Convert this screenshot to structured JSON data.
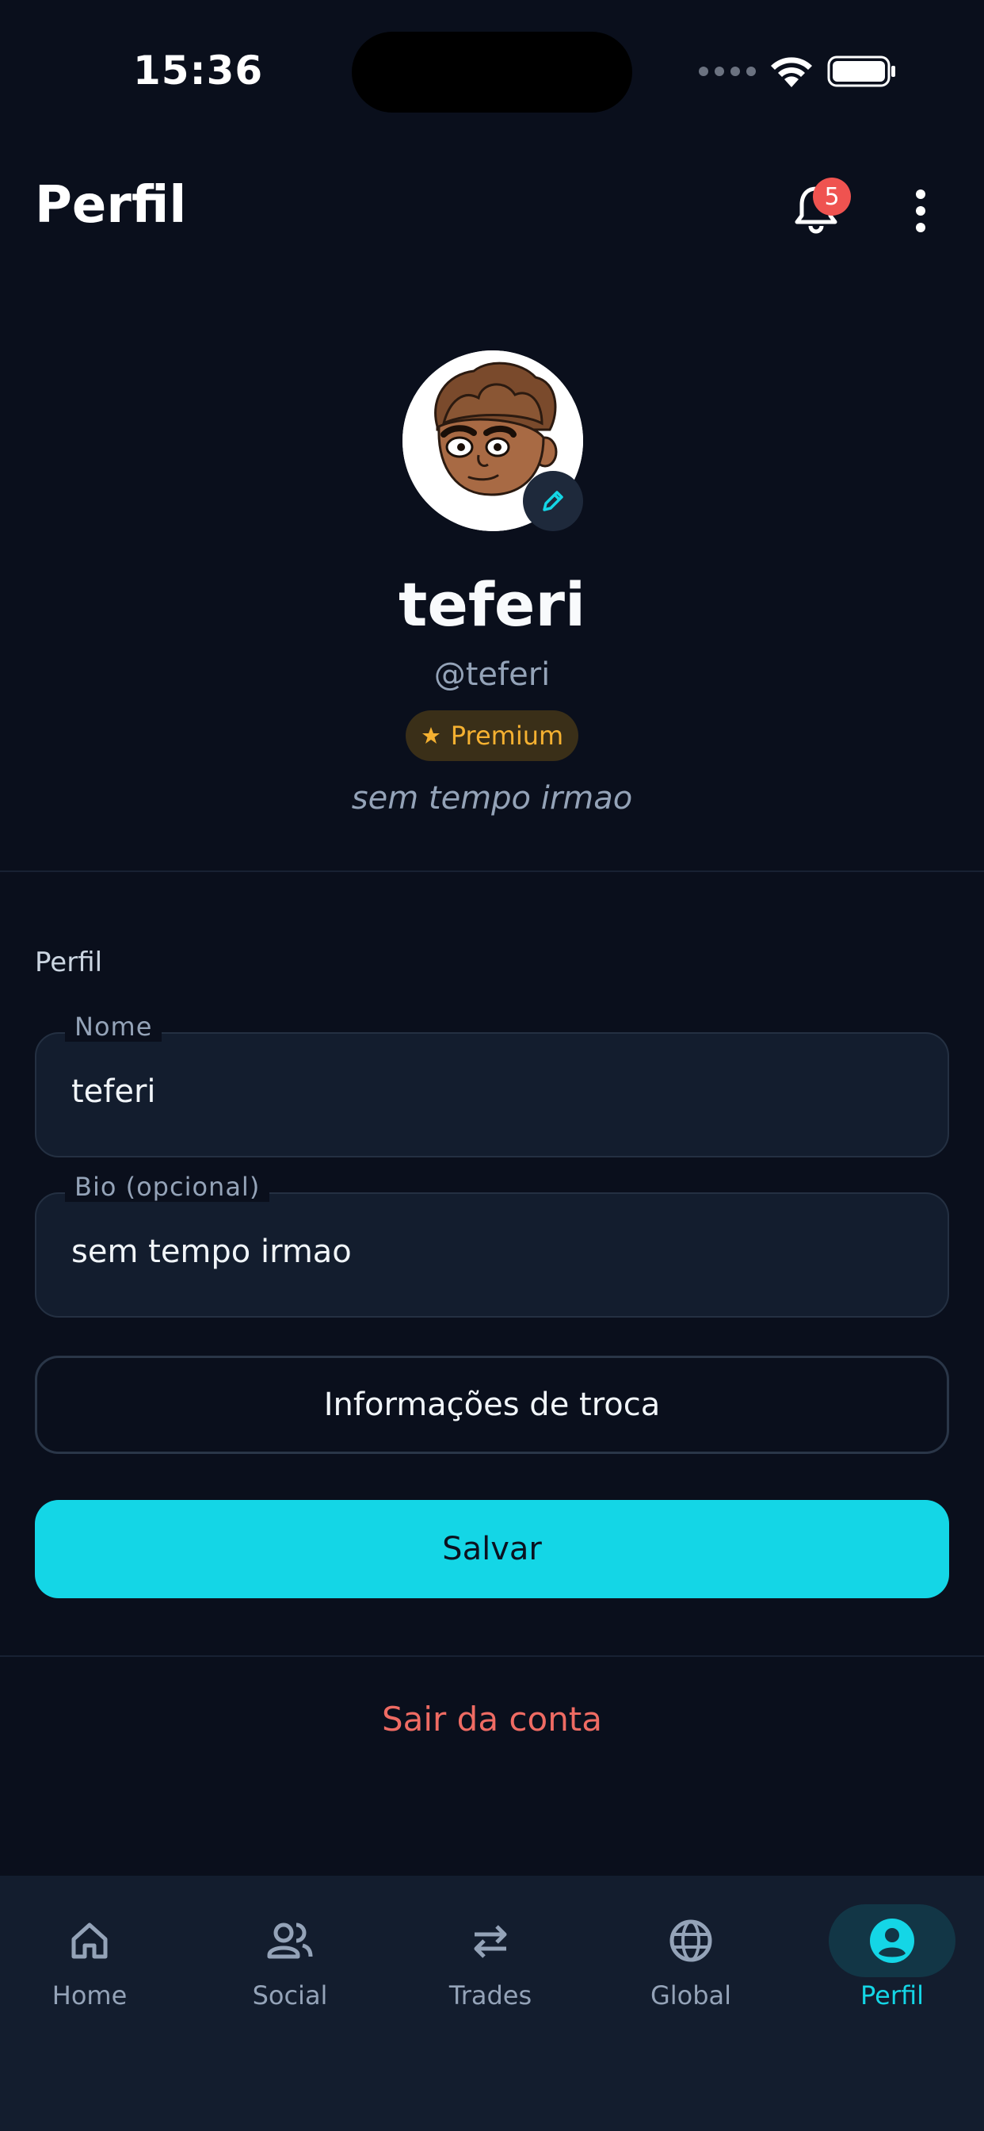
{
  "status_bar": {
    "time": "15:36"
  },
  "header": {
    "title": "Perfil",
    "notification_count": "5"
  },
  "profile": {
    "display_name": "teferi",
    "handle": "@teferi",
    "badge": {
      "label": "Premium",
      "icon": "star-icon",
      "color": "#f5b131"
    },
    "bio": "sem tempo irmao"
  },
  "form": {
    "section_label": "Perfil",
    "name_field": {
      "label": "Nome",
      "value": "teferi"
    },
    "bio_field": {
      "label": "Bio (opcional)",
      "value": "sem tempo irmao"
    },
    "trade_info_button": "Informações de troca",
    "save_button": "Salvar"
  },
  "logout_label": "Sair da conta",
  "nav": {
    "items": [
      {
        "label": "Home",
        "icon": "home-icon"
      },
      {
        "label": "Social",
        "icon": "people-icon"
      },
      {
        "label": "Trades",
        "icon": "swap-arrows-icon"
      },
      {
        "label": "Global",
        "icon": "globe-icon"
      },
      {
        "label": "Perfil",
        "icon": "account-circle-icon",
        "active": true
      }
    ]
  },
  "colors": {
    "background": "#0a0f1c",
    "accent": "#14d6e6",
    "danger": "#ef6b63",
    "badge": "#ef5350",
    "surface": "#131d2e"
  }
}
